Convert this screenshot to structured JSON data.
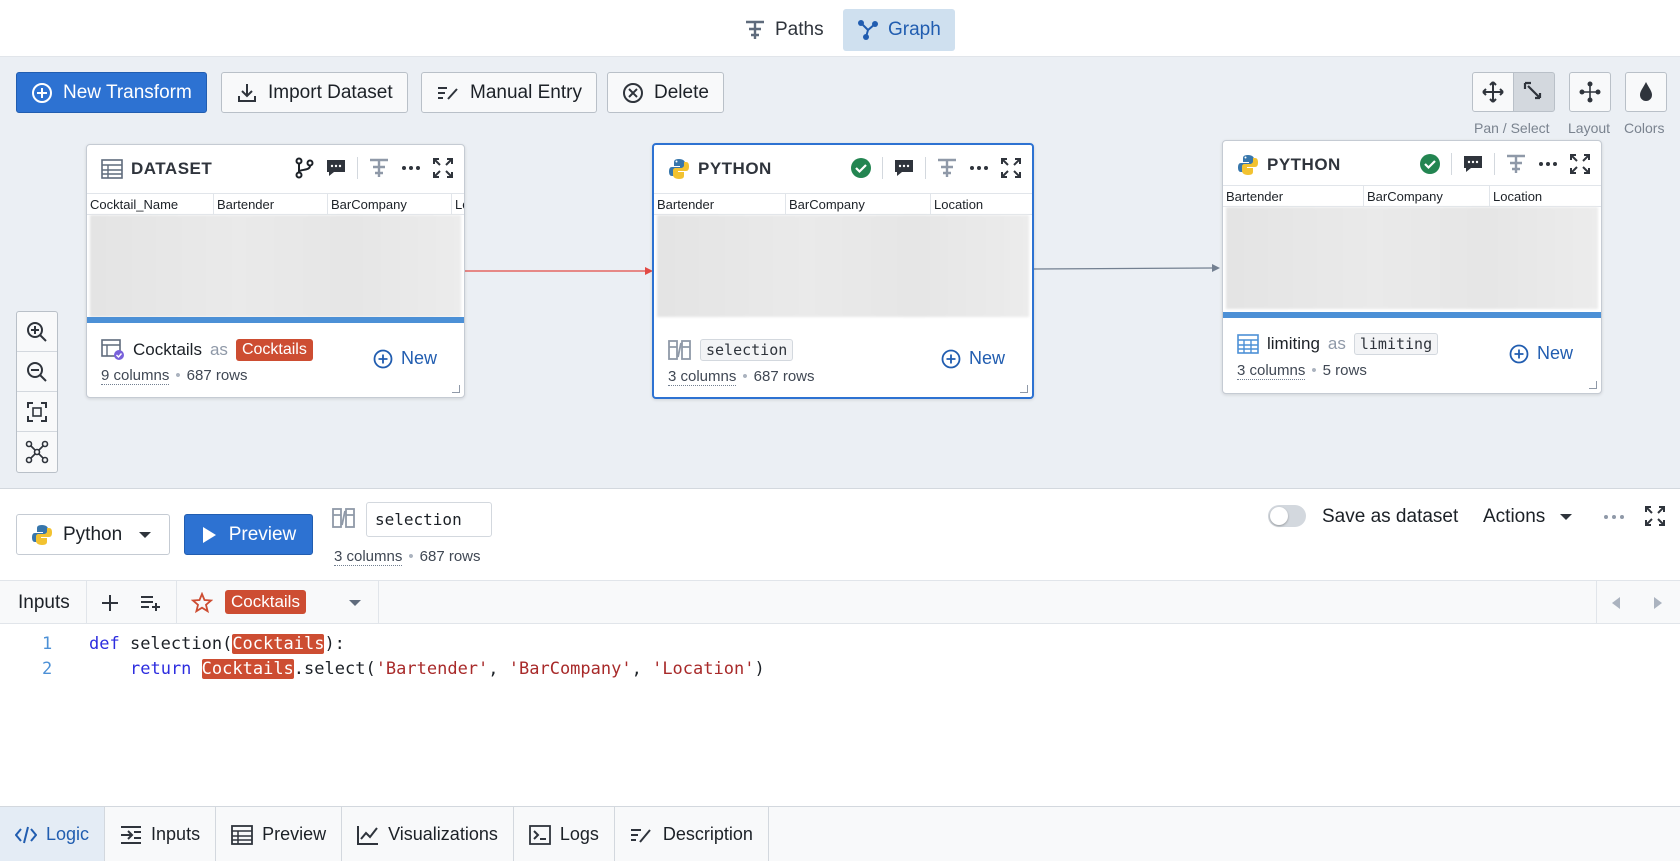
{
  "colors": {
    "accent": "#2d72d2",
    "tag": "#cd4d32",
    "success": "#238551",
    "edge_active": "#e24a45"
  },
  "top_tabs": [
    {
      "label": "Paths",
      "icon": "paths-icon"
    },
    {
      "label": "Graph",
      "icon": "graph-icon",
      "active": true
    }
  ],
  "toolbar": {
    "new_transform": "New Transform",
    "import_dataset": "Import Dataset",
    "manual_entry": "Manual Entry",
    "delete": "Delete",
    "pan_select_label": "Pan / Select",
    "layout_label": "Layout",
    "colors_label": "Colors"
  },
  "nodes": {
    "dataset": {
      "type": "DATASET",
      "columns": [
        "Cocktail_Name",
        "Bartender",
        "BarCompany",
        "Lo"
      ],
      "name": "Cocktails",
      "as": "as",
      "alias": "Cocktails",
      "columns_count": "9 columns",
      "rows_count": "687 rows",
      "new_label": "New"
    },
    "python1": {
      "type": "PYTHON",
      "columns": [
        "Bartender",
        "BarCompany",
        "Location"
      ],
      "name": "selection",
      "columns_count": "3 columns",
      "rows_count": "687 rows",
      "new_label": "New"
    },
    "python2": {
      "type": "PYTHON",
      "columns": [
        "Bartender",
        "BarCompany",
        "Location"
      ],
      "name": "limiting",
      "as": "as",
      "alias": "limiting",
      "columns_count": "3 columns",
      "rows_count": "5 rows",
      "new_label": "New"
    }
  },
  "editor": {
    "language": "Python",
    "preview": "Preview",
    "transform_name": "selection",
    "columns_count": "3 columns",
    "rows_count": "687 rows",
    "save_as_dataset": "Save as dataset",
    "actions": "Actions",
    "inputs_label": "Inputs",
    "input_tag": "Cocktails"
  },
  "code": {
    "lines": [
      {
        "num": "1",
        "kw1": "def",
        "fn": " selection(",
        "p1": "Cocktails",
        "tail": "):"
      },
      {
        "num": "2",
        "kw1": "return",
        "p1": "Cocktails",
        "mid": ".select(",
        "s1": "'Bartender'",
        "c1": ", ",
        "s2": "'BarCompany'",
        "c2": ", ",
        "s3": "'Location'",
        "tail": ")"
      }
    ]
  },
  "bottom_tabs": [
    {
      "label": "Logic",
      "icon": "code-icon",
      "active": true
    },
    {
      "label": "Inputs",
      "icon": "inputs-icon"
    },
    {
      "label": "Preview",
      "icon": "table-icon"
    },
    {
      "label": "Visualizations",
      "icon": "chart-icon"
    },
    {
      "label": "Logs",
      "icon": "console-icon"
    },
    {
      "label": "Description",
      "icon": "edit-icon"
    }
  ]
}
